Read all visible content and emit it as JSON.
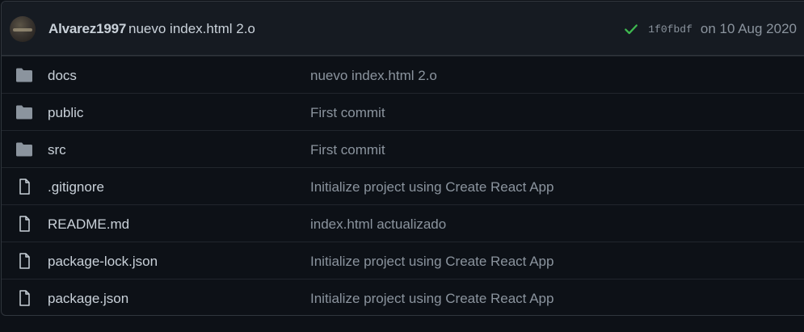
{
  "commit": {
    "author": "Alvarez1997",
    "message": "nuevo index.html 2.o",
    "sha": "1f0fbdf",
    "date": "on 10 Aug 2020",
    "status_icon": "check-icon",
    "status_color": "#3fb950"
  },
  "files": [
    {
      "name": "docs",
      "type": "folder",
      "icon": "folder-icon",
      "commit_message": "nuevo index.html 2.o"
    },
    {
      "name": "public",
      "type": "folder",
      "icon": "folder-icon",
      "commit_message": "First commit"
    },
    {
      "name": "src",
      "type": "folder",
      "icon": "folder-icon",
      "commit_message": "First commit"
    },
    {
      "name": ".gitignore",
      "type": "file",
      "icon": "file-icon",
      "commit_message": "Initialize project using Create React App"
    },
    {
      "name": "README.md",
      "type": "file",
      "icon": "file-icon",
      "commit_message": "index.html actualizado"
    },
    {
      "name": "package-lock.json",
      "type": "file",
      "icon": "file-icon",
      "commit_message": "Initialize project using Create React App"
    },
    {
      "name": "package.json",
      "type": "file",
      "icon": "file-icon",
      "commit_message": "Initialize project using Create React App"
    }
  ],
  "colors": {
    "background": "#0d1117",
    "header_bg": "#161b22",
    "border": "#30363d",
    "text": "#c9d1d9",
    "muted": "#8b949e",
    "icon": "#8b949e"
  }
}
